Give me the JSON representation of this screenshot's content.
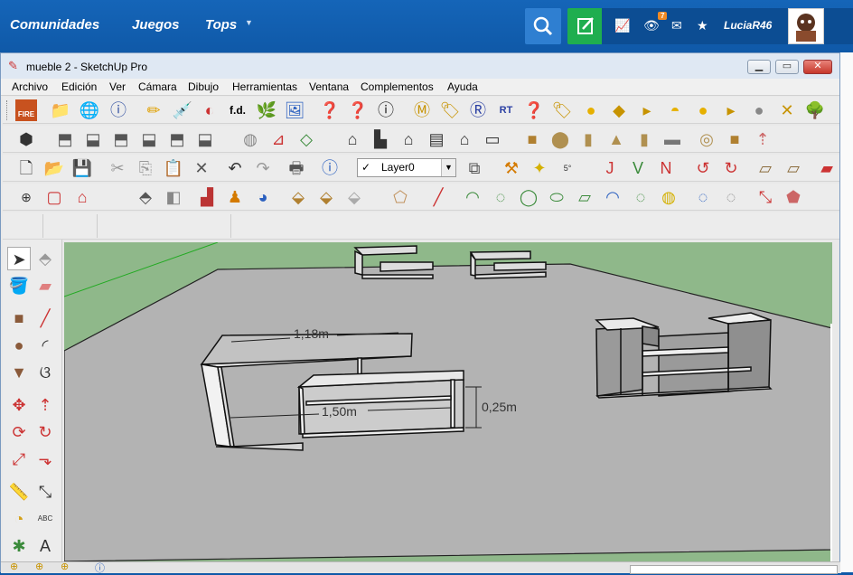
{
  "site": {
    "nav": [
      {
        "label": "Comunidades"
      },
      {
        "label": "Juegos"
      },
      {
        "label": "Tops"
      }
    ],
    "user": {
      "name": "LuciaR46",
      "notification_count": "7"
    }
  },
  "window": {
    "title": "mueble 2 - SketchUp Pro",
    "menu": [
      {
        "label": "Archivo"
      },
      {
        "label": "Edición"
      },
      {
        "label": "Ver"
      },
      {
        "label": "Cámara"
      },
      {
        "label": "Dibujo"
      },
      {
        "label": "Herramientas"
      },
      {
        "label": "Ventana"
      },
      {
        "label": "Complementos"
      },
      {
        "label": "Ayuda"
      }
    ],
    "layer": "Layer0",
    "toolbar_text": {
      "fire": "FIRE",
      "fd": "f.d."
    }
  },
  "model": {
    "dimensions": [
      {
        "label": "1,18m"
      },
      {
        "label": "1,50m"
      },
      {
        "label": "0,25m"
      }
    ]
  }
}
